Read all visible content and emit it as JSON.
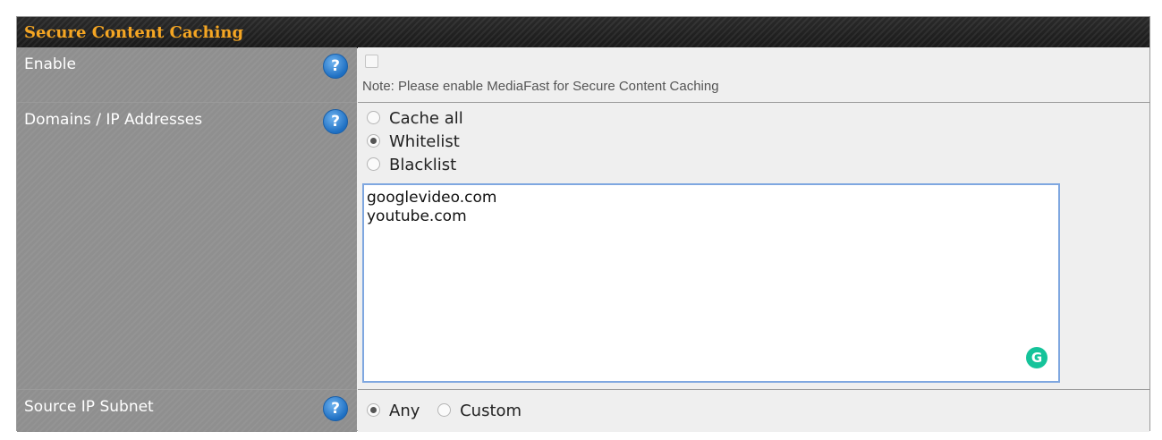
{
  "section": {
    "title": "Secure Content Caching"
  },
  "rows": {
    "enable": {
      "label": "Enable",
      "help_icon": "?",
      "checkbox_checked": false,
      "note": "Note: Please enable MediaFast for Secure Content Caching"
    },
    "domains": {
      "label": "Domains / IP Addresses",
      "help_icon": "?",
      "options": [
        {
          "label": "Cache all",
          "selected": false
        },
        {
          "label": "Whitelist",
          "selected": true
        },
        {
          "label": "Blacklist",
          "selected": false
        }
      ],
      "entries": [
        "googlevideo.com",
        "youtube.com"
      ],
      "grammarly_badge": "G"
    },
    "source_ip": {
      "label": "Source IP Subnet",
      "help_icon": "?",
      "options": [
        {
          "label": "Any",
          "selected": true
        },
        {
          "label": "Custom",
          "selected": false
        }
      ]
    }
  },
  "colors": {
    "header_text": "#f5a623",
    "help_icon": "#1e6fc2",
    "grammarly": "#15c39a",
    "textarea_focus": "#7fa7e0"
  }
}
